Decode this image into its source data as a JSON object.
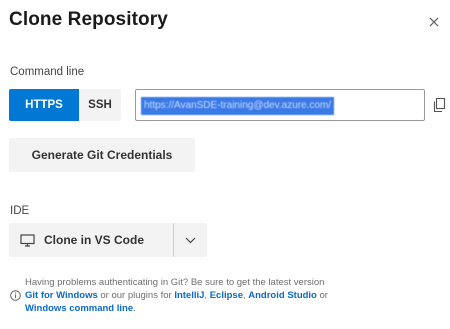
{
  "dialog": {
    "title": "Clone Repository",
    "close_icon": "close-icon"
  },
  "command_line": {
    "label": "Command line",
    "https_label": "HTTPS",
    "ssh_label": "SSH",
    "url": "https://AvanSDE-training@dev.azure.com/",
    "copy_icon": "copy-icon"
  },
  "generate_credentials_label": "Generate Git Credentials",
  "ide": {
    "label": "IDE",
    "clone_label": "Clone in VS Code",
    "vs_code_icon": "monitor-icon",
    "dropdown_icon": "chevron-down-icon"
  },
  "help": {
    "info_icon": "info-icon",
    "line1": "Having problems authenticating in Git? Be sure to get the latest version",
    "git_for_windows": "Git for Windows",
    "text_or_plugins": "or our plugins for",
    "intellij": "IntelliJ",
    "eclipse": "Eclipse",
    "android_studio": "Android Studio",
    "or": "or",
    "windows_command_line": "Windows command line",
    "comma": ",",
    "period": "."
  },
  "colors": {
    "accent": "#0078d4",
    "button_bg": "#f3f3f3",
    "link": "#0b6ac9",
    "selection": "#3b7ae6"
  }
}
